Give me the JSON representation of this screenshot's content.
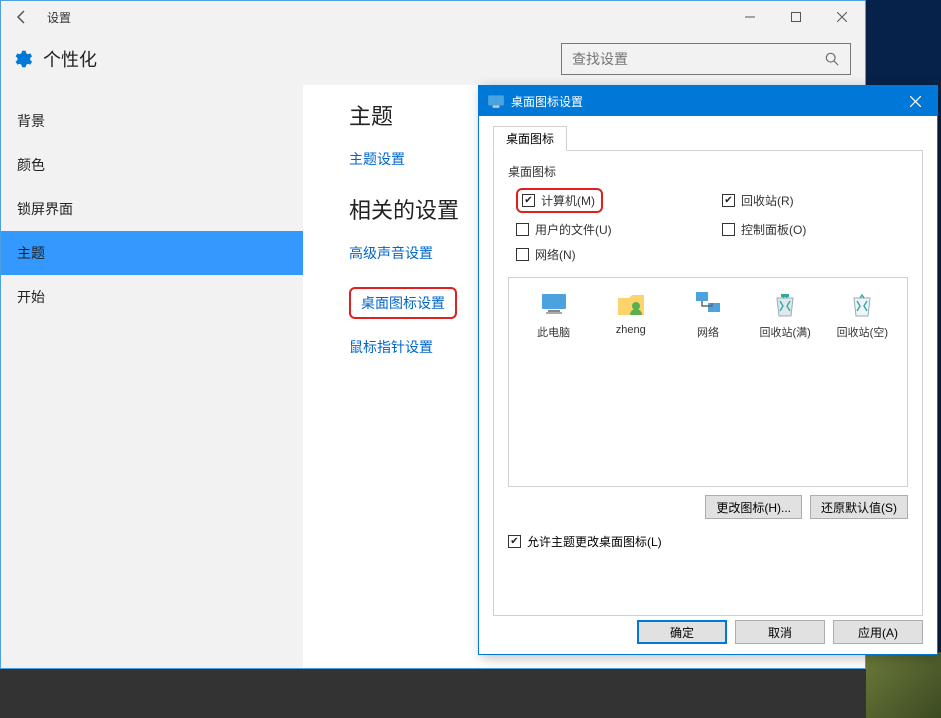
{
  "settings": {
    "window_title": "设置",
    "page_title": "个性化",
    "search_placeholder": "查找设置",
    "sidebar": [
      "背景",
      "颜色",
      "锁屏界面",
      "主题",
      "开始"
    ],
    "selected_index": 3,
    "section1": "主题",
    "link1": "主题设置",
    "section2": "相关的设置",
    "link2": "高级声音设置",
    "link3": "桌面图标设置",
    "link4": "鼠标指针设置"
  },
  "dialog": {
    "title": "桌面图标设置",
    "tab": "桌面图标",
    "group_label": "桌面图标",
    "checks": {
      "computer": {
        "label": "计算机(M)",
        "checked": true,
        "highlighted": true
      },
      "recycle": {
        "label": "回收站(R)",
        "checked": true
      },
      "userfiles": {
        "label": "用户的文件(U)",
        "checked": false
      },
      "controlpanel": {
        "label": "控制面板(O)",
        "checked": false
      },
      "network": {
        "label": "网络(N)",
        "checked": false
      }
    },
    "previews": [
      "此电脑",
      "zheng",
      "网络",
      "回收站(满)",
      "回收站(空)"
    ],
    "btn_change": "更改图标(H)...",
    "btn_restore": "还原默认值(S)",
    "allow_theme": {
      "label": "允许主题更改桌面图标(L)",
      "checked": true
    },
    "ok": "确定",
    "cancel": "取消",
    "apply": "应用(A)"
  }
}
